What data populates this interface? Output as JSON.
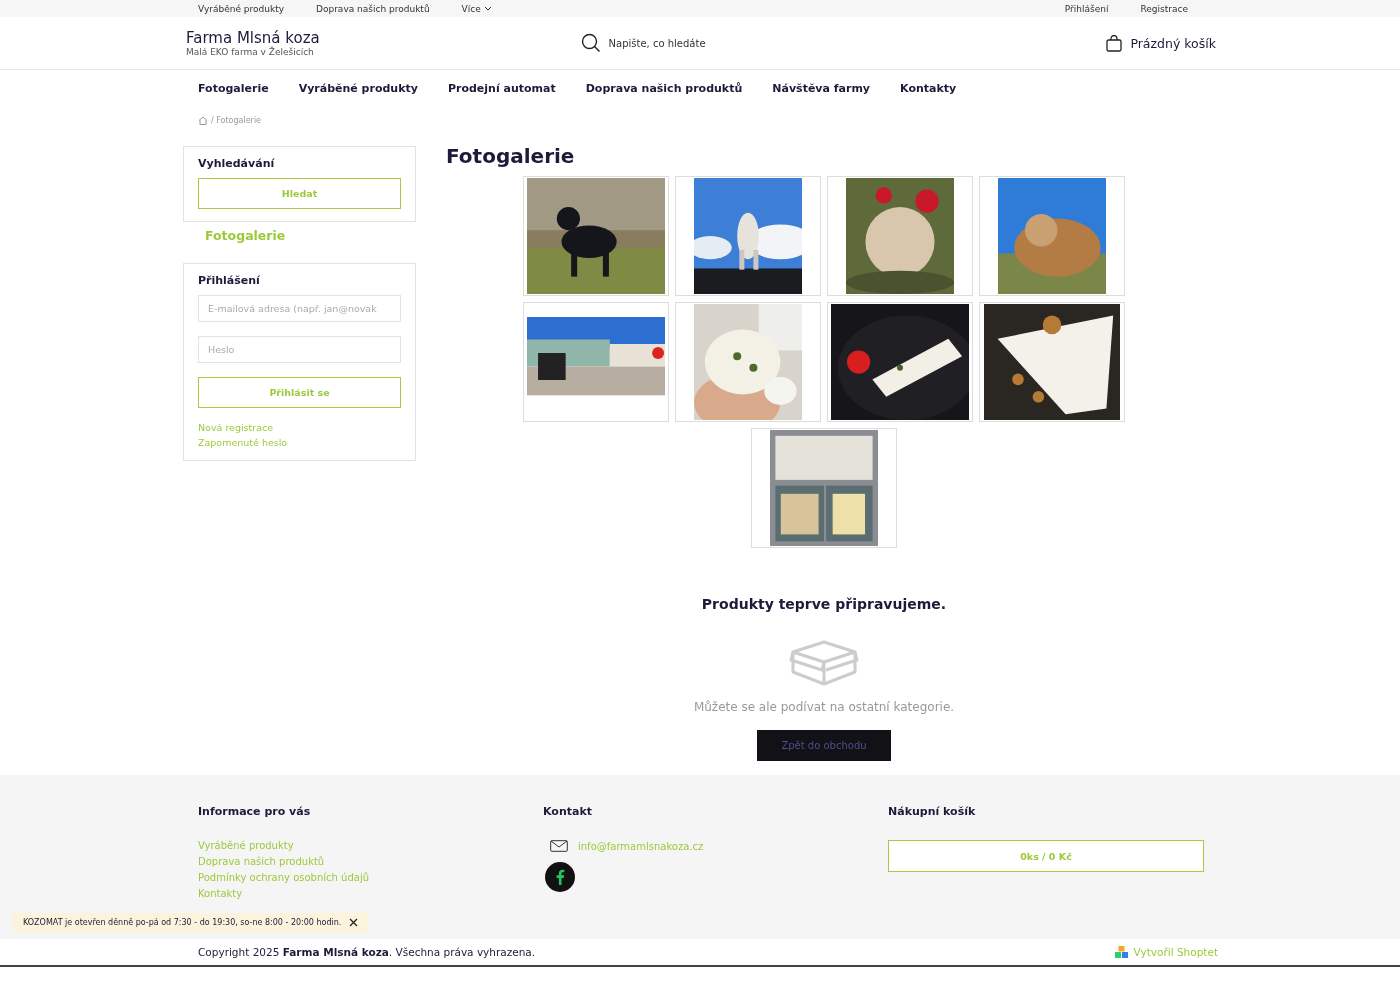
{
  "top_bar": {
    "links": [
      "Vyráběné produkty",
      "Doprava našich produktů",
      "Více"
    ],
    "account_links": [
      "Přihlášení",
      "Registrace"
    ]
  },
  "header": {
    "title": "Farma Mlsná koza",
    "subtitle": "Malá EKO farma v Želešicích",
    "search": {
      "placeholder": "Napište, co hledáte"
    },
    "cart": "Prázdný košík"
  },
  "nav": [
    {
      "label": "Fotogalerie",
      "selected": false
    },
    {
      "label": "Vyráběné produkty",
      "selected": false
    },
    {
      "label": "Prodejní automat",
      "selected": false
    },
    {
      "label": "Doprava našich produktů",
      "selected": false
    },
    {
      "label": "Návštěva farmy",
      "selected": false
    },
    {
      "label": "Kontakty",
      "selected": false
    }
  ],
  "breadcrumb": "/ Fotogalerie",
  "sidebar": {
    "search_title": "Vyhledávání",
    "search_button": "Hledat",
    "category": "Fotogalerie",
    "login_title": "Přihlášení",
    "email": {
      "placeholder": "E-mailová adresa (např. jan@novak"
    },
    "password": {
      "placeholder": "Heslo"
    },
    "login_button": "Přihlásit se",
    "links": [
      "Nová registrace",
      "Zapomenuté heslo"
    ]
  },
  "page_title": "Fotogalerie",
  "empty": {
    "title": "Produkty teprve připravujeme.",
    "text": "Můžete se ale podívat na ostatní kategorie.",
    "button": "Zpět do obchodu"
  },
  "footer": {
    "info_title": "Informace pro vás",
    "info_links": [
      "Vyráběné produkty",
      "Doprava našich produktů",
      "Podmínky ochrany osobních údajů",
      "Kontakty"
    ],
    "contact_title": "Kontakt",
    "email": "info@farmamlsnakoza.cz",
    "cart_title": "Nákupní košík",
    "cart_button": "0ks / 0 Kč"
  },
  "copyright": "Copyright 2025 **Farma Mlsná koza**. Všechna práva vyhrazena.",
  "credit": "Vytvořil Shoptet",
  "notice": "KOZOMAT je otevřen děnně po-pá od 7:30 - do 19:30, so-ne 8:00 - 20:00 hodin."
}
